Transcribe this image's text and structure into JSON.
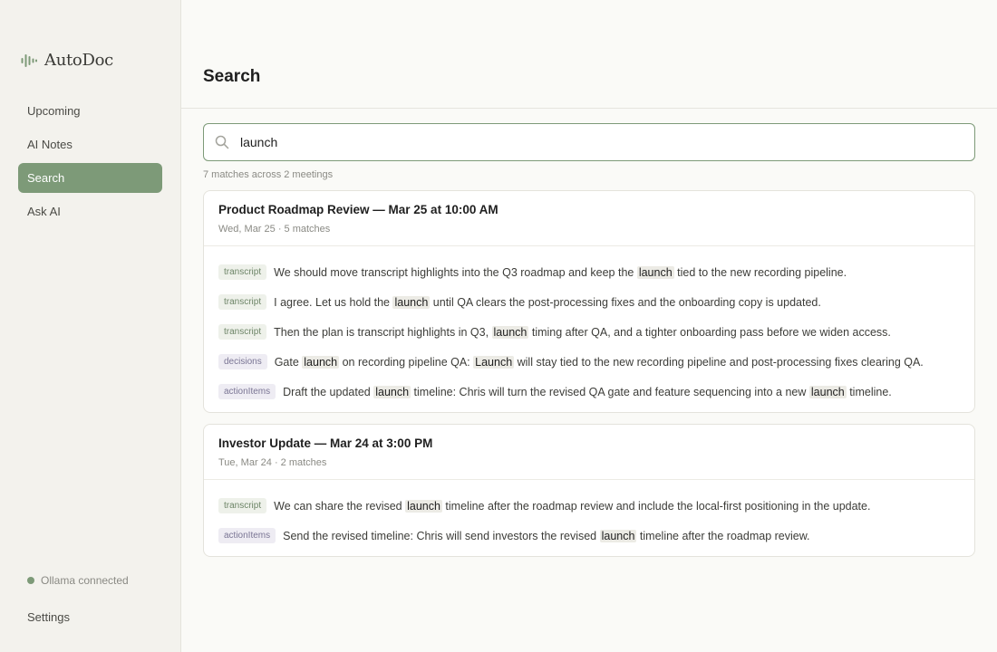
{
  "app": {
    "name": "AutoDoc"
  },
  "sidebar": {
    "items": [
      {
        "label": "Upcoming",
        "active": false
      },
      {
        "label": "AI Notes",
        "active": false
      },
      {
        "label": "Search",
        "active": true
      },
      {
        "label": "Ask AI",
        "active": false
      }
    ],
    "status": "Ollama connected",
    "settings_label": "Settings"
  },
  "page": {
    "title": "Search"
  },
  "search": {
    "value": "launch",
    "summary": "7 matches across 2 meetings"
  },
  "colors": {
    "accent": "#7d9a78",
    "background": "#fafaf7",
    "sidebar": "#f3f2ed"
  },
  "icons": {
    "brand": "sound-wave-icon",
    "search": "search-icon",
    "status": "status-dot-icon"
  },
  "results": [
    {
      "title": "Product Roadmap Review — Mar 25 at 10:00 AM",
      "meta": "Wed, Mar 25 · 5 matches",
      "matches": [
        {
          "tag": "transcript",
          "parts": [
            {
              "t": "We should move transcript highlights into the Q3 roadmap and keep the ",
              "h": false
            },
            {
              "t": "launch",
              "h": true
            },
            {
              "t": " tied to the new recording pipeline.",
              "h": false
            }
          ]
        },
        {
          "tag": "transcript",
          "parts": [
            {
              "t": "I agree. Let us hold the ",
              "h": false
            },
            {
              "t": "launch",
              "h": true
            },
            {
              "t": " until QA clears the post-processing fixes and the onboarding copy is updated.",
              "h": false
            }
          ]
        },
        {
          "tag": "transcript",
          "parts": [
            {
              "t": "Then the plan is transcript highlights in Q3, ",
              "h": false
            },
            {
              "t": "launch",
              "h": true
            },
            {
              "t": " timing after QA, and a tighter onboarding pass before we widen access.",
              "h": false
            }
          ]
        },
        {
          "tag": "decisions",
          "parts": [
            {
              "t": "Gate ",
              "h": false
            },
            {
              "t": "launch",
              "h": true
            },
            {
              "t": " on recording pipeline QA: ",
              "h": false
            },
            {
              "t": "Launch",
              "h": true
            },
            {
              "t": " will stay tied to the new recording pipeline and post-processing fixes clearing QA.",
              "h": false
            }
          ]
        },
        {
          "tag": "actionItems",
          "parts": [
            {
              "t": "Draft the updated ",
              "h": false
            },
            {
              "t": "launch",
              "h": true
            },
            {
              "t": " timeline: Chris will turn the revised QA gate and feature sequencing into a new ",
              "h": false
            },
            {
              "t": "launch",
              "h": true
            },
            {
              "t": " timeline.",
              "h": false
            }
          ]
        }
      ]
    },
    {
      "title": "Investor Update — Mar 24 at 3:00 PM",
      "meta": "Tue, Mar 24 · 2 matches",
      "matches": [
        {
          "tag": "transcript",
          "parts": [
            {
              "t": "We can share the revised ",
              "h": false
            },
            {
              "t": "launch",
              "h": true
            },
            {
              "t": " timeline after the roadmap review and include the local-first positioning in the update.",
              "h": false
            }
          ]
        },
        {
          "tag": "actionItems",
          "parts": [
            {
              "t": "Send the revised timeline: Chris will send investors the revised ",
              "h": false
            },
            {
              "t": "launch",
              "h": true
            },
            {
              "t": " timeline after the roadmap review.",
              "h": false
            }
          ]
        }
      ]
    }
  ]
}
